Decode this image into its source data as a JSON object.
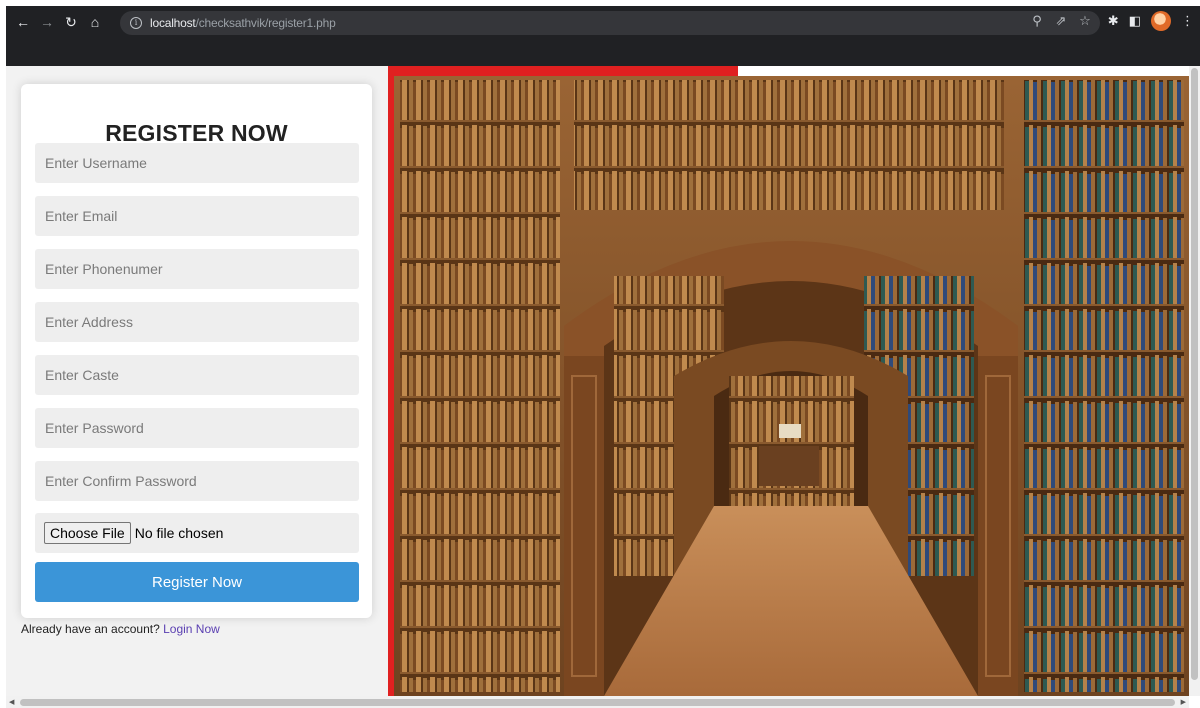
{
  "browser": {
    "url_host": "localhost",
    "url_path": "/checksathvik/register1.php",
    "icons": {
      "back": "back-arrow-icon",
      "forward": "forward-arrow-icon",
      "reload": "reload-icon",
      "home": "home-icon",
      "site_info": "info-icon",
      "zoom": "zoom-icon",
      "share": "share-icon",
      "bookmark": "star-icon",
      "extensions": "puzzle-icon",
      "side_panel": "side-panel-icon",
      "profile": "avatar",
      "menu": "kebab-menu-icon"
    }
  },
  "form": {
    "title": "REGISTER NOW",
    "fields": [
      {
        "placeholder": "Enter Username",
        "value": ""
      },
      {
        "placeholder": "Enter Email",
        "value": ""
      },
      {
        "placeholder": "Enter Phonenumer",
        "value": ""
      },
      {
        "placeholder": "Enter Address",
        "value": ""
      },
      {
        "placeholder": "Enter Caste",
        "value": ""
      },
      {
        "placeholder": "Enter Password",
        "value": ""
      },
      {
        "placeholder": "Enter Confirm Password",
        "value": ""
      }
    ],
    "file_button": "Choose File",
    "file_status": "No file chosen",
    "submit_label": "Register Now",
    "login_prompt": "Already have an account?",
    "login_link": "Login Now"
  },
  "colors": {
    "accent_button": "#3b95d8",
    "link": "#5a3fb1",
    "panel_border_red": "#e02020",
    "wood": "#8a5a32"
  }
}
